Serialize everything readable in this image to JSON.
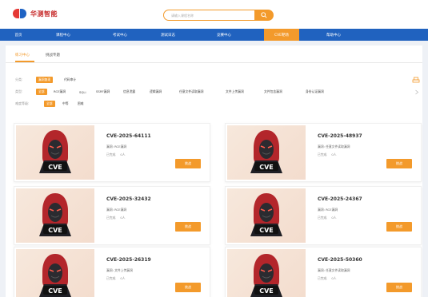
{
  "header": {
    "logo_text": "华测智能",
    "search_placeholder": "请输入课程名称"
  },
  "nav": {
    "items": [
      {
        "label": "首页",
        "active": false
      },
      {
        "label": "课程中心",
        "active": false
      },
      {
        "label": "考试中心",
        "active": false
      },
      {
        "label": "测试日志",
        "active": false
      },
      {
        "label": "竞赛中心",
        "active": false
      },
      {
        "label": "CVE靶场",
        "active": true
      },
      {
        "label": "帮助中心",
        "active": false
      }
    ]
  },
  "tabs": [
    {
      "label": "练习中心",
      "active": true
    },
    {
      "label": "挑战专题",
      "active": false
    }
  ],
  "filters": {
    "type": {
      "label": "分类:",
      "chips": [
        {
          "label": "漏洞复现",
          "active": true
        },
        {
          "label": "代码审计",
          "active": false
        }
      ]
    },
    "category": {
      "label": "类型:",
      "chips": [
        {
          "label": "全部",
          "active": true
        },
        {
          "label": "RCE漏洞",
          "active": false
        },
        {
          "label": "SQLi",
          "active": false
        },
        {
          "label": "SSRF漏洞",
          "active": false
        },
        {
          "label": "信息泄露",
          "active": false
        },
        {
          "label": "逻辑漏洞",
          "active": false
        },
        {
          "label": "任意文件读取漏洞",
          "active": false
        },
        {
          "label": "文件上传漏洞",
          "active": false
        },
        {
          "label": "文件包含漏洞",
          "active": false
        },
        {
          "label": "身份认证漏洞",
          "active": false
        }
      ]
    },
    "difficulty": {
      "label": "难度等级:",
      "chips": [
        {
          "label": "全部",
          "active": true
        },
        {
          "label": "中等",
          "active": false
        },
        {
          "label": "困难",
          "active": false
        }
      ]
    }
  },
  "cards": [
    {
      "title": "CVE-2025-64111",
      "subtitle": "漏洞: RCE漏洞",
      "done": "已完成",
      "attempts": "0人",
      "button": "挑战"
    },
    {
      "title": "CVE-2025-48937",
      "subtitle": "漏洞: 任意文件读取漏洞",
      "done": "已完成",
      "attempts": "0人",
      "button": "挑战"
    },
    {
      "title": "CVE-2025-32432",
      "subtitle": "漏洞: RCE漏洞",
      "done": "已完成",
      "attempts": "0人",
      "button": "挑战"
    },
    {
      "title": "CVE-2025-24367",
      "subtitle": "漏洞: RCE漏洞",
      "done": "已完成",
      "attempts": "0人",
      "button": "挑战"
    },
    {
      "title": "CVE-2025-26319",
      "subtitle": "漏洞: 文件上传漏洞",
      "done": "已完成",
      "attempts": "0人",
      "button": "挑战"
    },
    {
      "title": "CVE-2025-50360",
      "subtitle": "漏洞: 任意文件读取漏洞",
      "done": "已完成",
      "attempts": "0人",
      "button": "挑战"
    }
  ],
  "card_image_text": "CVE",
  "colors": {
    "accent": "#f39a2b",
    "nav": "#2062bf",
    "background": "#eef1f6"
  }
}
